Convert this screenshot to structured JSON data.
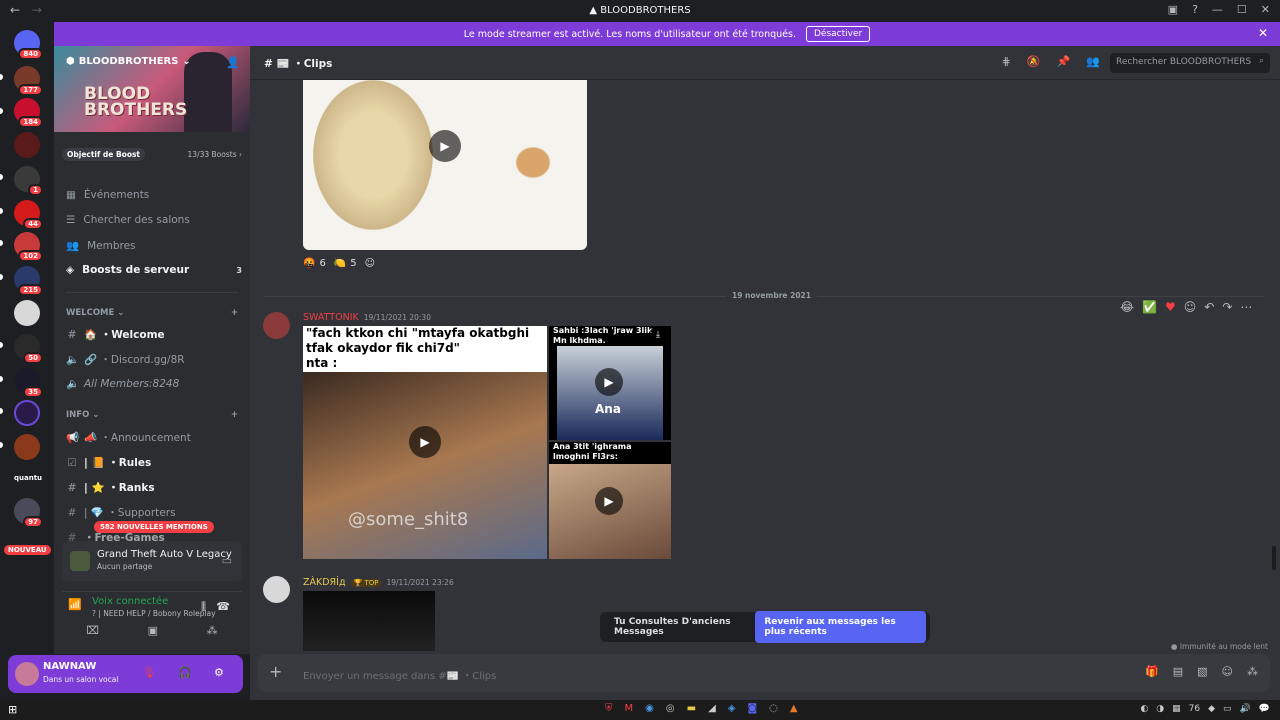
{
  "window": {
    "title": "BLOODBROTHERS",
    "back": "←",
    "forward": "→"
  },
  "banner": {
    "text": "Le mode streamer est activé. Les noms d'utilisateur ont été tronqués.",
    "button": "Désactiver"
  },
  "rail": {
    "badges": [
      "840",
      "177",
      "184",
      "",
      "1",
      "44",
      "102",
      "215",
      "50",
      "35",
      "",
      "",
      "",
      "97"
    ],
    "nouveau": "NOUVEAU",
    "label_quant": "quantu"
  },
  "server": {
    "name": "BLOODBROTHERS",
    "logo_line1": "BLOOD",
    "logo_line2": "BROTHERS",
    "boost_label": "Objectif de Boost",
    "boost_count": "13/33 Boosts"
  },
  "menu": [
    {
      "label": "Événements",
      "count": ""
    },
    {
      "label": "Chercher des salons",
      "count": ""
    },
    {
      "label": "Membres",
      "count": ""
    },
    {
      "label": "Boosts de serveur",
      "count": "3"
    }
  ],
  "categories": {
    "welcome": "WELCOME",
    "info": "INFO"
  },
  "channels": {
    "welcome": "🏠 ・Welcome",
    "discord": "🔗 ・Discord.gg/8R",
    "members": "All Members:8248",
    "announcement": "📣 ・Announcement",
    "rules": "| 📙 ・Rules",
    "ranks": "| ⭐ ・Ranks",
    "supporters": "| 💎 ・Supporters",
    "freegames": "・Free-Games"
  },
  "mentions": "582 NOUVELLES MENTIONS",
  "activity": {
    "game": "Grand Theft Auto V Legacy",
    "sub": "Aucun partage"
  },
  "voice": {
    "status": "Voix connectée",
    "channel": "? | NEED HELP / Bobony Roleplay"
  },
  "user": {
    "name": "NAWNAW",
    "status": "Dans un salon vocal"
  },
  "channel_header": {
    "name": "Clips",
    "search_placeholder": "Rechercher BLOODBROTHERS"
  },
  "reactions": [
    {
      "emoji": "🤬",
      "count": "6"
    },
    {
      "emoji": "🍋",
      "count": "5"
    },
    {
      "emoji": "☺",
      "count": ""
    }
  ],
  "date_divider": "19 novembre 2021",
  "messages": [
    {
      "author": "SWATTONIK",
      "timestamp": "19/11/2021 20:30",
      "media": [
        {
          "caption": "\"fach ktkon chi \"mtayfa okatbghi tfak okaydor fik chi7d\"\nnta :",
          "watermark": "@some_shit8"
        },
        {
          "caption": "Sahbi :3lach 'jraw 3lik Mn lkhdma.",
          "label": "Ana"
        },
        {
          "caption": "Ana 3tit 'ighrama lmoghni Fl3rs:"
        }
      ]
    },
    {
      "author": "ZÀKDЯİд",
      "tag": "🏆 TOP",
      "timestamp": "19/11/2021 23:26"
    }
  ],
  "old_messages": {
    "text": "Tu Consultes D'anciens Messages",
    "button": "Revenir aux messages les plus récents"
  },
  "slowmode": "Immunité au mode lent",
  "composer": {
    "placeholder": "Envoyer un message dans #📰 ・Clips"
  },
  "taskbar": {
    "temp": "76"
  }
}
